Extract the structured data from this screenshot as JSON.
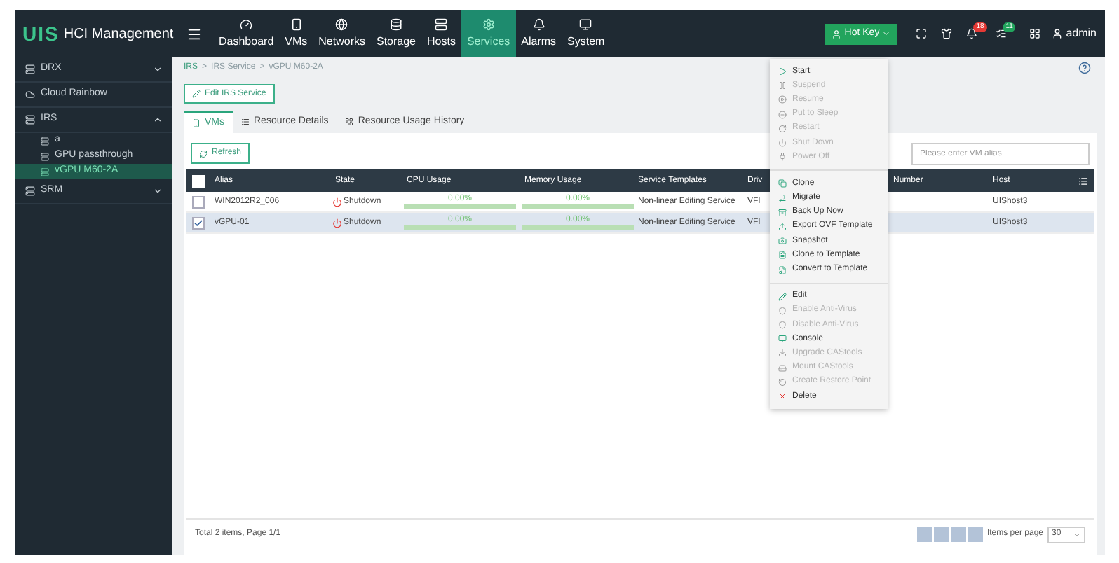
{
  "app": {
    "logo": "UIS",
    "title": "HCI Management"
  },
  "nav": [
    {
      "label": "Dashboard",
      "selected": false
    },
    {
      "label": "VMs",
      "selected": false
    },
    {
      "label": "Networks",
      "selected": false
    },
    {
      "label": "Storage",
      "selected": false
    },
    {
      "label": "Hosts",
      "selected": false
    },
    {
      "label": "Services",
      "selected": true
    },
    {
      "label": "Alarms",
      "selected": false
    },
    {
      "label": "System",
      "selected": false
    }
  ],
  "header_right": {
    "hot_key": "Hot Key",
    "alarm_count": "18",
    "task_count": "11",
    "user": "admin"
  },
  "sidebar": [
    {
      "label": "DRX",
      "expanded": false,
      "selected": false
    },
    {
      "label": "Cloud Rainbow",
      "selected": false
    },
    {
      "label": "IRS",
      "expanded": true,
      "selected": false,
      "children": [
        {
          "label": "a",
          "selected": false
        },
        {
          "label": "GPU passthrough",
          "selected": false
        },
        {
          "label": "vGPU M60-2A",
          "selected": true
        }
      ]
    },
    {
      "label": "SRM",
      "expanded": false,
      "selected": false
    }
  ],
  "breadcrumb": {
    "items": [
      "IRS",
      "IRS Service",
      "vGPU M60-2A"
    ],
    "separator": ">"
  },
  "edit_button": "Edit IRS Service",
  "tabs": [
    {
      "label": "VMs",
      "selected": true
    },
    {
      "label": "Resource Details",
      "selected": false
    },
    {
      "label": "Resource Usage History",
      "selected": false
    }
  ],
  "refresh_button": "Refresh",
  "search": {
    "placeholder": "Please enter VM alias"
  },
  "table": {
    "select_all": {
      "checked": false
    },
    "columns": [
      "Alias",
      "State",
      "CPU Usage",
      "Memory Usage",
      "Service Templates",
      "Driv",
      "Number",
      "Host"
    ],
    "rows": [
      {
        "checked": false,
        "alias": "WIN2012R2_006",
        "state": "Shutdown",
        "cpu": {
          "reading": "0.00%",
          "level": 0
        },
        "memory": {
          "reading": "0.00%",
          "level": 0
        },
        "template": "Non-linear Editing Service",
        "driver": "VFI",
        "host": "UIShost3"
      },
      {
        "checked": true,
        "alias": "vGPU-01",
        "state": "Shutdown",
        "cpu": {
          "reading": "0.00%",
          "level": 0
        },
        "memory": {
          "reading": "0.00%",
          "level": 0
        },
        "template": "Non-linear Editing Service",
        "driver": "VFI",
        "host": "UIShost3"
      }
    ]
  },
  "footer": {
    "summary": "Total 2 items, Page 1/1",
    "per_page_label": "Items per page",
    "per_page": "30"
  },
  "menu": [
    [
      {
        "label": "Start",
        "disabled": false
      },
      {
        "label": "Suspend",
        "disabled": true
      },
      {
        "label": "Resume",
        "disabled": true
      },
      {
        "label": "Put to Sleep",
        "disabled": true
      },
      {
        "label": "Restart",
        "disabled": true
      },
      {
        "label": "Shut Down",
        "disabled": true
      },
      {
        "label": "Power Off",
        "disabled": true
      }
    ],
    [
      {
        "label": "Clone",
        "disabled": false
      },
      {
        "label": "Migrate",
        "disabled": false
      },
      {
        "label": "Back Up Now",
        "disabled": false
      },
      {
        "label": "Export OVF Template",
        "disabled": false
      },
      {
        "label": "Snapshot",
        "disabled": false
      },
      {
        "label": "Clone to Template",
        "disabled": false
      },
      {
        "label": "Convert to Template",
        "disabled": false
      }
    ],
    [
      {
        "label": "Edit",
        "disabled": false
      },
      {
        "label": "Enable Anti-Virus",
        "disabled": true
      },
      {
        "label": "Disable Anti-Virus",
        "disabled": true
      },
      {
        "label": "Console",
        "disabled": false
      },
      {
        "label": "Upgrade CAStools",
        "disabled": true
      },
      {
        "label": "Mount CAStools",
        "disabled": true
      },
      {
        "label": "Create Restore Point",
        "disabled": true
      },
      {
        "label": "Delete",
        "disabled": false
      }
    ]
  ]
}
